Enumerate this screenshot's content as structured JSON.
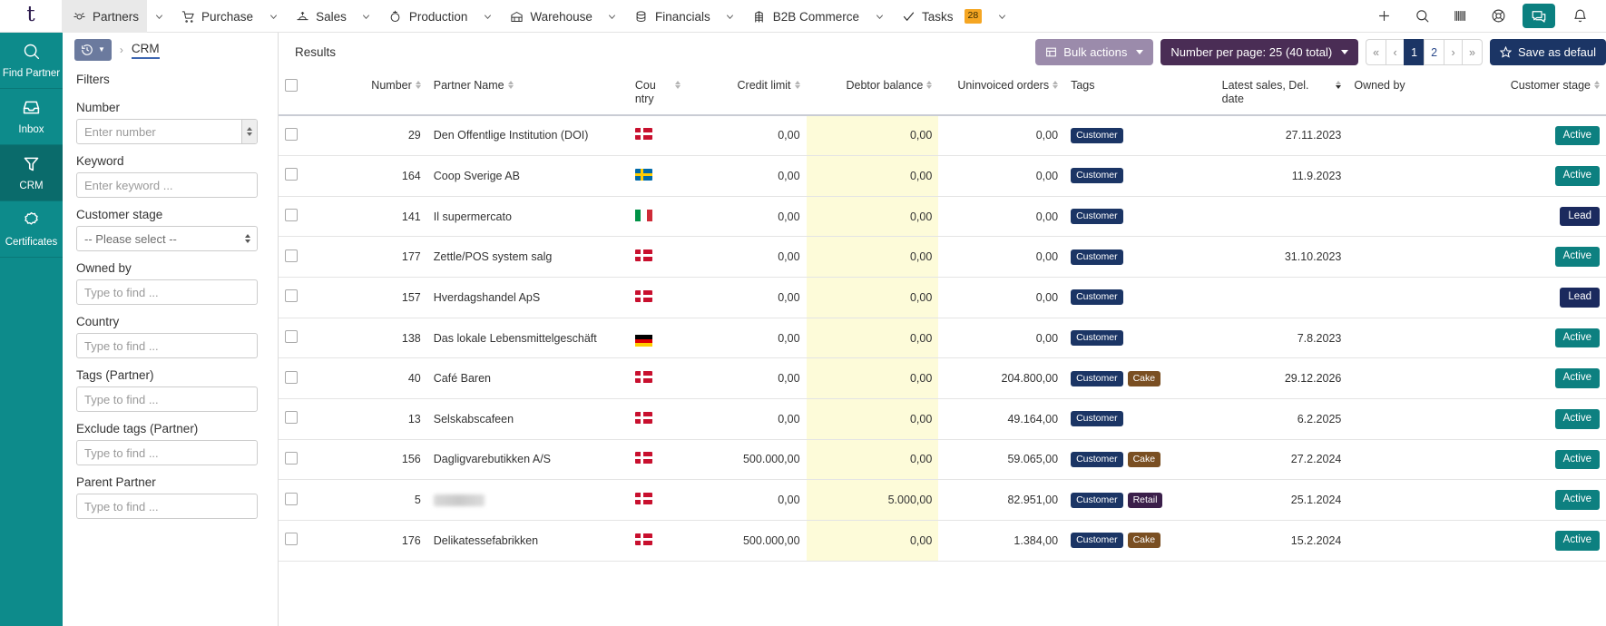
{
  "topbar": {
    "logo": "t",
    "nav": [
      {
        "label": "Partners",
        "icon": "handshake-icon",
        "active": true
      },
      {
        "label": "Purchase",
        "icon": "cart-icon",
        "active": false
      },
      {
        "label": "Sales",
        "icon": "sales-icon",
        "active": false
      },
      {
        "label": "Production",
        "icon": "production-icon",
        "active": false
      },
      {
        "label": "Warehouse",
        "icon": "warehouse-icon",
        "active": false
      },
      {
        "label": "Financials",
        "icon": "coins-icon",
        "active": false
      },
      {
        "label": "B2B Commerce",
        "icon": "b2b-icon",
        "active": false
      },
      {
        "label": "Tasks",
        "icon": "check-icon",
        "active": false,
        "badge": "28"
      }
    ],
    "right_icons": [
      {
        "name": "plus-icon"
      },
      {
        "name": "search-icon"
      },
      {
        "name": "barcode-icon"
      },
      {
        "name": "lifebuoy-icon"
      },
      {
        "name": "chat-icon",
        "highlighted": true
      },
      {
        "name": "bell-icon"
      }
    ]
  },
  "sidebar": {
    "items": [
      {
        "label": "Find Partner",
        "icon": "search-icon",
        "active": false
      },
      {
        "label": "Inbox",
        "icon": "inbox-icon",
        "active": false
      },
      {
        "label": "CRM",
        "icon": "funnel-icon",
        "active": true
      },
      {
        "label": "Certificates",
        "icon": "certificate-icon",
        "active": false
      }
    ]
  },
  "breadcrumb": {
    "history_icon": "history-icon",
    "current": "CRM"
  },
  "filters": {
    "title": "Filters",
    "fields": [
      {
        "label": "Number",
        "placeholder": "Enter number",
        "value": "",
        "type": "number"
      },
      {
        "label": "Keyword",
        "placeholder": "Enter keyword ...",
        "value": "",
        "type": "text"
      },
      {
        "label": "Customer stage",
        "placeholder": "-- Please select --",
        "value": "-- Please select --",
        "type": "select"
      },
      {
        "label": "Owned by",
        "placeholder": "Type to find ...",
        "value": "",
        "type": "text"
      },
      {
        "label": "Country",
        "placeholder": "Type to find ...",
        "value": "",
        "type": "text"
      },
      {
        "label": "Tags (Partner)",
        "placeholder": "Type to find ...",
        "value": "",
        "type": "text"
      },
      {
        "label": "Exclude tags (Partner)",
        "placeholder": "Type to find ...",
        "value": "",
        "type": "text"
      },
      {
        "label": "Parent Partner",
        "placeholder": "Type to find ...",
        "value": "",
        "type": "text"
      }
    ]
  },
  "results": {
    "title": "Results",
    "bulk_actions_label": "Bulk actions",
    "per_page_label": "Number per page: 25 (40 total)",
    "save_default_label": "Save as defaul",
    "pagination": [
      {
        "label": "«",
        "active": false,
        "muted": true
      },
      {
        "label": "‹",
        "active": false,
        "muted": true
      },
      {
        "label": "1",
        "active": true,
        "muted": false
      },
      {
        "label": "2",
        "active": false,
        "muted": false
      },
      {
        "label": "›",
        "active": false,
        "muted": true
      },
      {
        "label": "»",
        "active": false,
        "muted": true
      }
    ],
    "columns": [
      {
        "label": "",
        "sortable": false,
        "align": "left"
      },
      {
        "label": "Number",
        "sortable": true,
        "align": "right"
      },
      {
        "label": "Partner Name",
        "sortable": true,
        "align": "left"
      },
      {
        "label": "Cou ntry",
        "sortable": true,
        "align": "left"
      },
      {
        "label": "Credit limit",
        "sortable": true,
        "align": "right"
      },
      {
        "label": "Debtor balance",
        "sortable": true,
        "align": "right"
      },
      {
        "label": "Uninvoiced orders",
        "sortable": true,
        "align": "right"
      },
      {
        "label": "Tags",
        "sortable": false,
        "align": "left"
      },
      {
        "label": "Latest sales, Del. date",
        "sortable": true,
        "sort_active": true,
        "align": "right"
      },
      {
        "label": "Owned by",
        "sortable": false,
        "align": "left"
      },
      {
        "label": "Customer stage",
        "sortable": true,
        "align": "right"
      }
    ],
    "rows": [
      {
        "number": "29",
        "name": "Den Offentlige Institution (DOI)",
        "country": "dk",
        "credit_limit": "0,00",
        "debtor_balance": "0,00",
        "uninvoiced": "0,00",
        "tags": [
          "Customer"
        ],
        "latest_date": "27.11.2023",
        "owned_by": "",
        "stage": "Active"
      },
      {
        "number": "164",
        "name": "Coop Sverige AB",
        "country": "se",
        "credit_limit": "0,00",
        "debtor_balance": "0,00",
        "uninvoiced": "0,00",
        "tags": [
          "Customer"
        ],
        "latest_date": "11.9.2023",
        "owned_by": "",
        "stage": "Active"
      },
      {
        "number": "141",
        "name": "Il supermercato",
        "country": "it",
        "credit_limit": "0,00",
        "debtor_balance": "0,00",
        "uninvoiced": "0,00",
        "tags": [
          "Customer"
        ],
        "latest_date": "",
        "owned_by": "",
        "stage": "Lead"
      },
      {
        "number": "177",
        "name": "Zettle/POS system salg",
        "country": "dk",
        "credit_limit": "0,00",
        "debtor_balance": "0,00",
        "uninvoiced": "0,00",
        "tags": [
          "Customer"
        ],
        "latest_date": "31.10.2023",
        "owned_by": "",
        "stage": "Active"
      },
      {
        "number": "157",
        "name": "Hverdagshandel ApS",
        "country": "dk",
        "credit_limit": "0,00",
        "debtor_balance": "0,00",
        "uninvoiced": "0,00",
        "tags": [
          "Customer"
        ],
        "latest_date": "",
        "owned_by": "",
        "stage": "Lead"
      },
      {
        "number": "138",
        "name": "Das lokale Lebensmittelgeschäft",
        "country": "de",
        "credit_limit": "0,00",
        "debtor_balance": "0,00",
        "uninvoiced": "0,00",
        "tags": [
          "Customer"
        ],
        "latest_date": "7.8.2023",
        "owned_by": "",
        "stage": "Active"
      },
      {
        "number": "40",
        "name": "Café Baren",
        "country": "dk",
        "credit_limit": "0,00",
        "debtor_balance": "0,00",
        "uninvoiced": "204.800,00",
        "tags": [
          "Customer",
          "Cake"
        ],
        "latest_date": "29.12.2026",
        "owned_by": "",
        "stage": "Active"
      },
      {
        "number": "13",
        "name": "Selskabscafeen",
        "country": "dk",
        "credit_limit": "0,00",
        "debtor_balance": "0,00",
        "uninvoiced": "49.164,00",
        "tags": [
          "Customer"
        ],
        "latest_date": "6.2.2025",
        "owned_by": "",
        "stage": "Active"
      },
      {
        "number": "156",
        "name": "Dagligvarebutikken A/S",
        "country": "dk",
        "credit_limit": "500.000,00",
        "debtor_balance": "0,00",
        "uninvoiced": "59.065,00",
        "tags": [
          "Customer",
          "Cake"
        ],
        "latest_date": "27.2.2024",
        "owned_by": "",
        "stage": "Active"
      },
      {
        "number": "5",
        "name": "",
        "redacted": true,
        "country": "dk",
        "credit_limit": "0,00",
        "debtor_balance": "5.000,00",
        "uninvoiced": "82.951,00",
        "tags": [
          "Customer",
          "Retail"
        ],
        "latest_date": "25.1.2024",
        "owned_by": "",
        "stage": "Active"
      },
      {
        "number": "176",
        "name": "Delikatessefabrikken",
        "country": "dk",
        "credit_limit": "500.000,00",
        "debtor_balance": "0,00",
        "uninvoiced": "1.384,00",
        "tags": [
          "Customer",
          "Cake"
        ],
        "latest_date": "15.2.2024",
        "owned_by": "",
        "stage": "Active"
      }
    ]
  },
  "colors": {
    "teal": "#0d8b8b",
    "navy": "#1b3565",
    "purple": "#4a2d55",
    "purple_light": "#9b8bab",
    "tag_brown": "#7a4f22",
    "badge_orange": "#f5a623",
    "debtor_highlight": "#fdfbd9"
  }
}
